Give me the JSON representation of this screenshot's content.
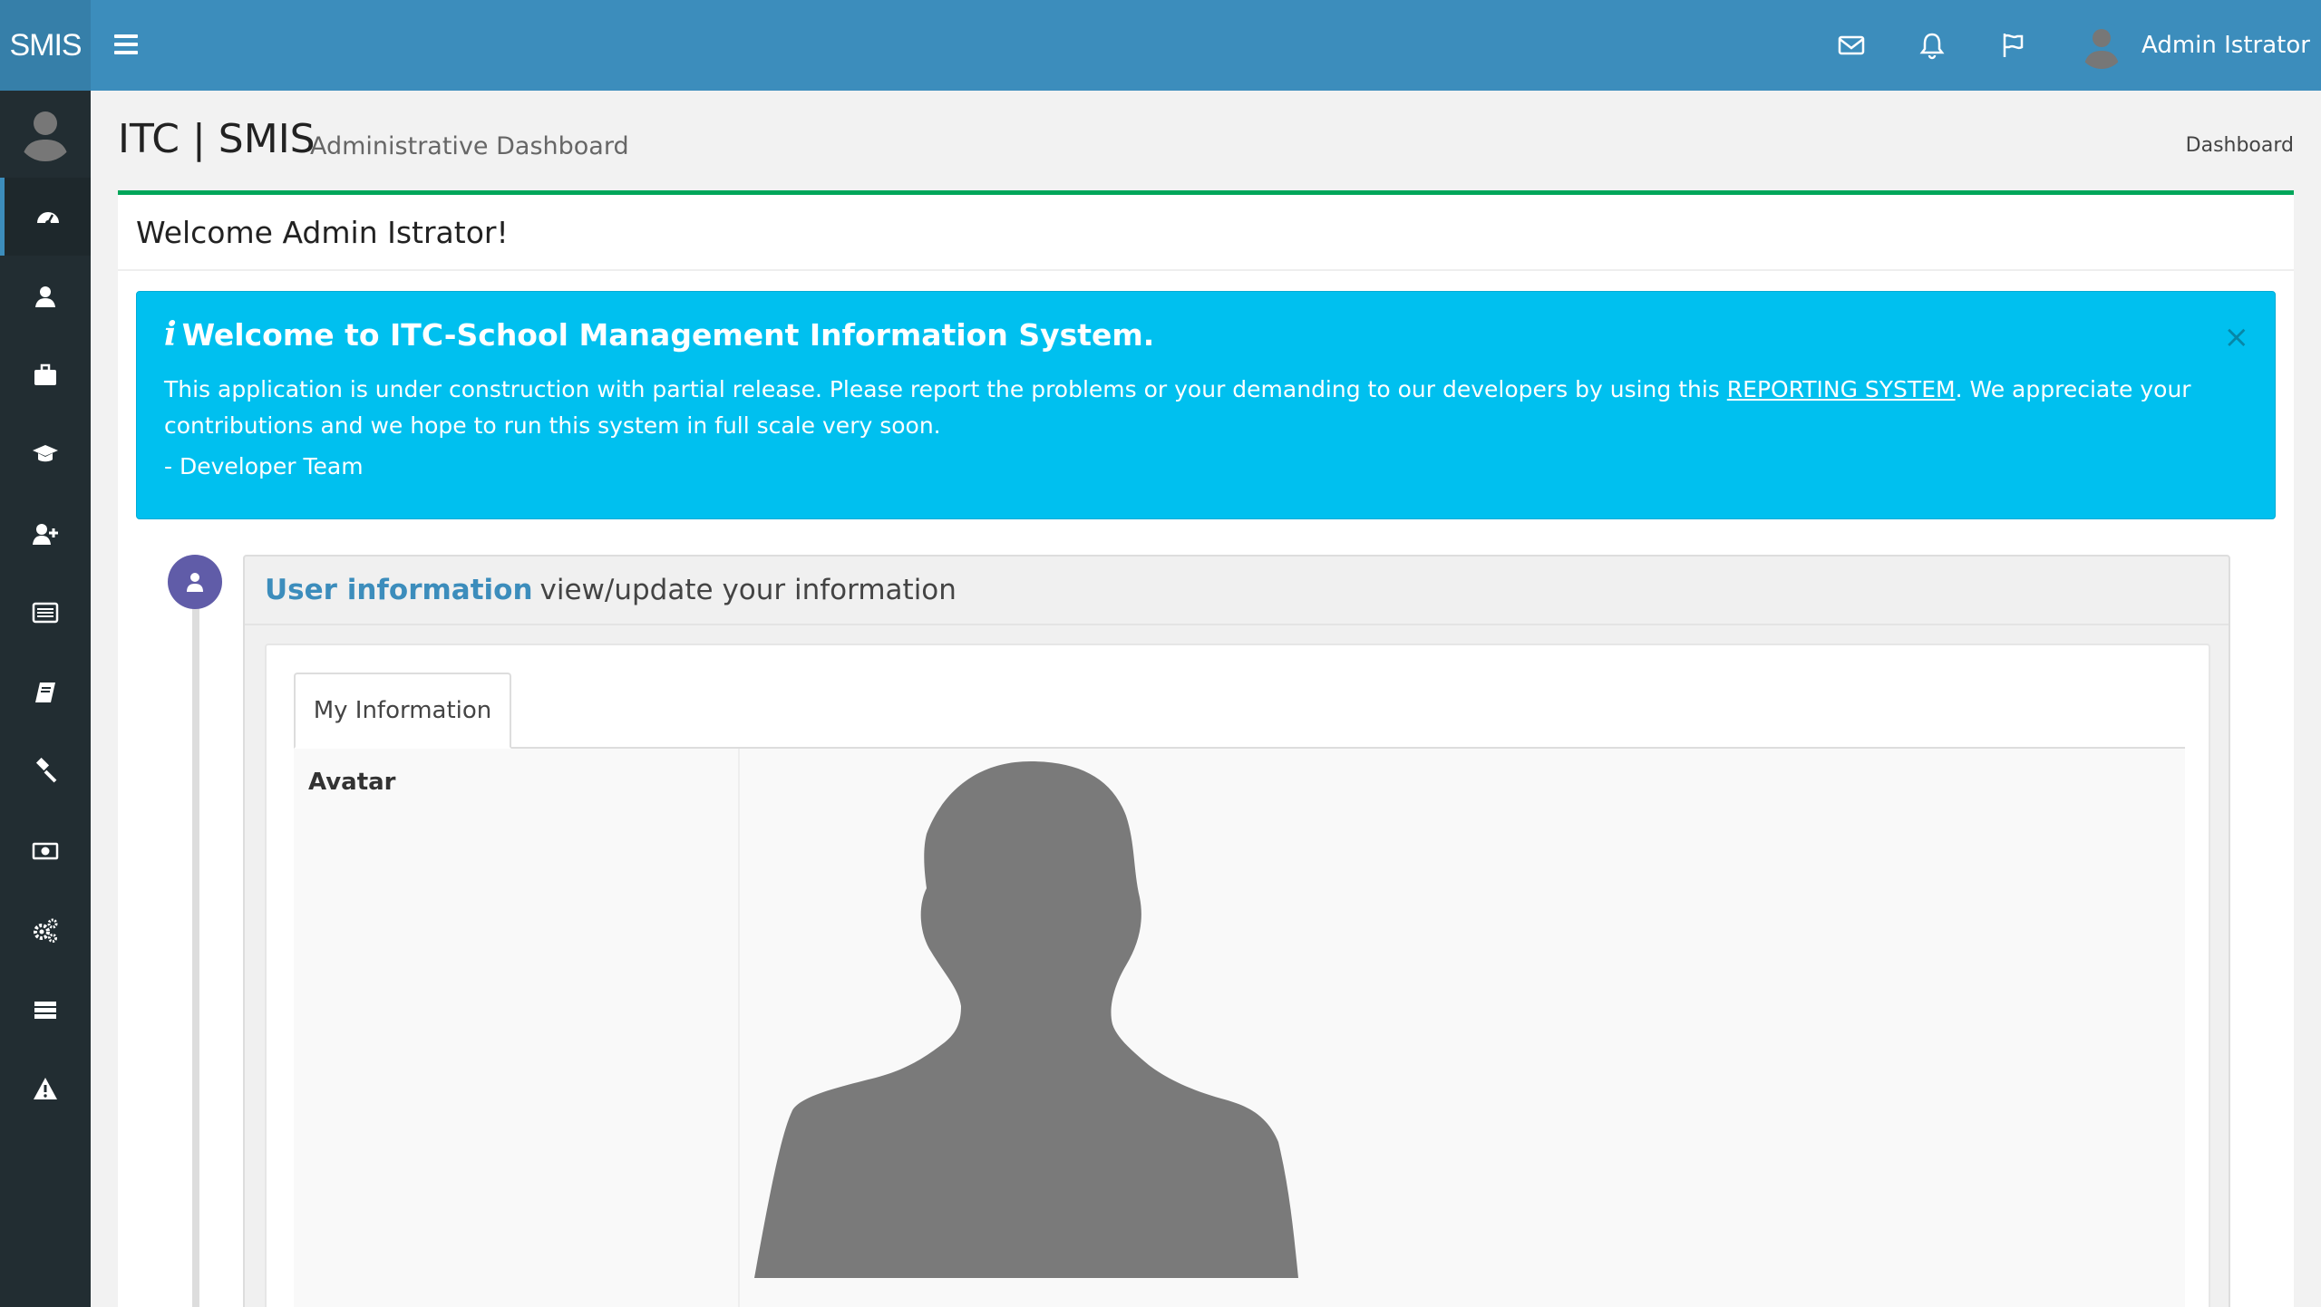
{
  "navbar": {
    "logo": "SMIS",
    "user_name": "Admin Istrator",
    "icons": [
      "menu-icon",
      "envelope-icon",
      "bell-icon",
      "flag-icon"
    ]
  },
  "sidebar": {
    "items": [
      {
        "icon": "dashboard-icon",
        "active": true
      },
      {
        "icon": "user-icon"
      },
      {
        "icon": "briefcase-icon"
      },
      {
        "icon": "graduation-cap-icon"
      },
      {
        "icon": "user-plus-icon"
      },
      {
        "icon": "list-icon"
      },
      {
        "icon": "book-icon"
      },
      {
        "icon": "gavel-icon"
      },
      {
        "icon": "money-icon"
      },
      {
        "icon": "cogs-icon"
      },
      {
        "icon": "server-icon"
      },
      {
        "icon": "warning-icon"
      }
    ]
  },
  "header": {
    "title": "ITC | SMIS",
    "subtitle": "Administrative Dashboard",
    "breadcrumb": "Dashboard"
  },
  "welcome_box": {
    "title": "Welcome Admin Istrator!"
  },
  "alert": {
    "title": "Welcome to ITC-School Management Information System.",
    "body_before": "This application is under construction with partial release. Please report the problems or your demanding to our developers by using this ",
    "link": "REPORTING SYSTEM",
    "body_after": ". We appreciate your contributions and we hope to run this system in full scale very soon.",
    "signature": "- Developer Team",
    "close": "×"
  },
  "timeline": {
    "heading_strong": "User information",
    "heading_rest": "view/update your information",
    "tab_label": "My Information",
    "rows": [
      {
        "label": "Avatar"
      }
    ]
  },
  "colors": {
    "primary": "#3c8dbc",
    "sidebar": "#222d32",
    "success": "#00a65a",
    "info": "#00c0ef",
    "purple": "#605ca8"
  }
}
